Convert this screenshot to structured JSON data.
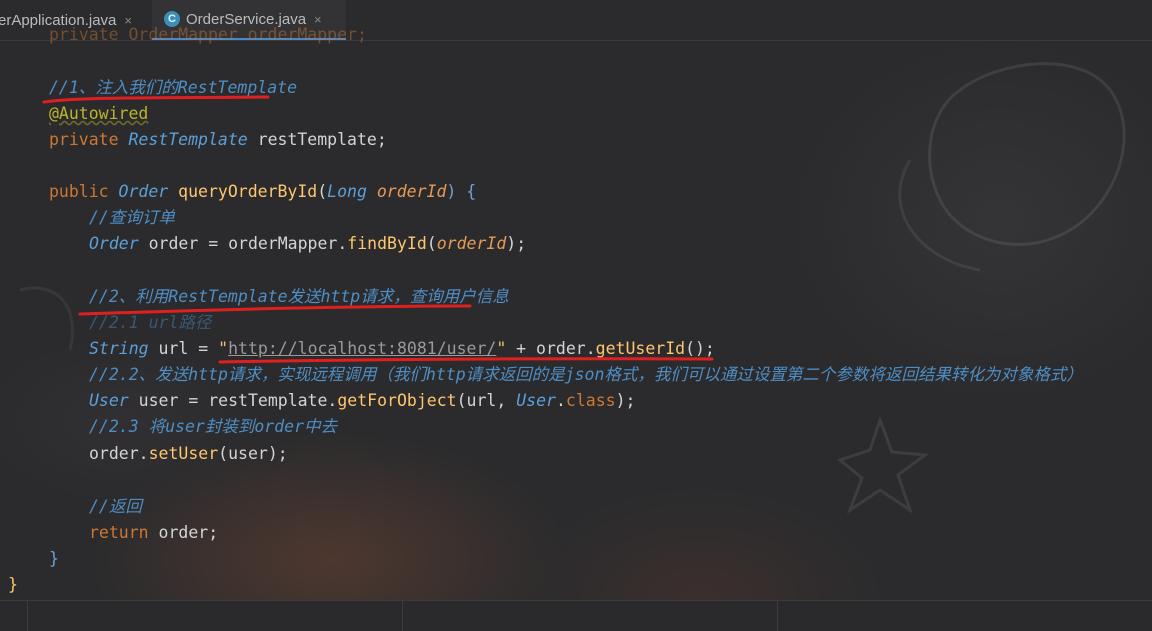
{
  "tabs": [
    {
      "label": "erApplication.java",
      "close": "×"
    },
    {
      "label": "OrderService.java",
      "icon": "C",
      "close": "×"
    }
  ],
  "code": {
    "line0": "private OrderMapper orderMapper;",
    "line1": "//1、注入我们的RestTemplate",
    "line2": "@Autowired",
    "line3_kw": "private ",
    "line3_type": "RestTemplate",
    "line3_rest": " restTemplate;",
    "line4_kw": "public ",
    "line4_type": "Order",
    "line4_fn": " queryOrderById",
    "line4_p1": "(",
    "line4_ptype": "Long",
    "line4_pname": " orderId",
    "line4_p2": ") {",
    "line5": "//查询订单",
    "line6_type": "Order",
    "line6_a": " order = orderMapper.",
    "line6_fn": "findById",
    "line6_b": "(",
    "line6_param": "orderId",
    "line6_c": ");",
    "line7": "//2、利用RestTemplate发送http请求，查询用户信息",
    "line8": "//2.1 url路径",
    "line9_type": "String",
    "line9_a": " url = ",
    "line9_q1": "\"",
    "line9_url": "http://localhost:8081/user/",
    "line9_q2": "\"",
    "line9_b": " + order.",
    "line9_fn": "getUserId",
    "line9_c": "();",
    "line10": "//2.2、发送http请求，实现远程调用（我们http请求返回的是json格式，我们可以通过设置第二个参数将返回结果转化为对象格式）",
    "line11_type": "User",
    "line11_a": " user = restTemplate.",
    "line11_fn": "getForObject",
    "line11_b": "(url, ",
    "line11_type2": "User",
    "line11_c": ".",
    "line11_kw": "class",
    "line11_d": ");",
    "line12": "//2.3 将user封装到order中去",
    "line13_a": "order.",
    "line13_fn": "setUser",
    "line13_b": "(user);",
    "line14": "//返回",
    "line15_kw": "return",
    "line15_rest": " order;",
    "line16": "}",
    "line17": "}"
  },
  "colors": {
    "annotation_red": "#e02020",
    "accent_tab": "#4a88c7"
  }
}
